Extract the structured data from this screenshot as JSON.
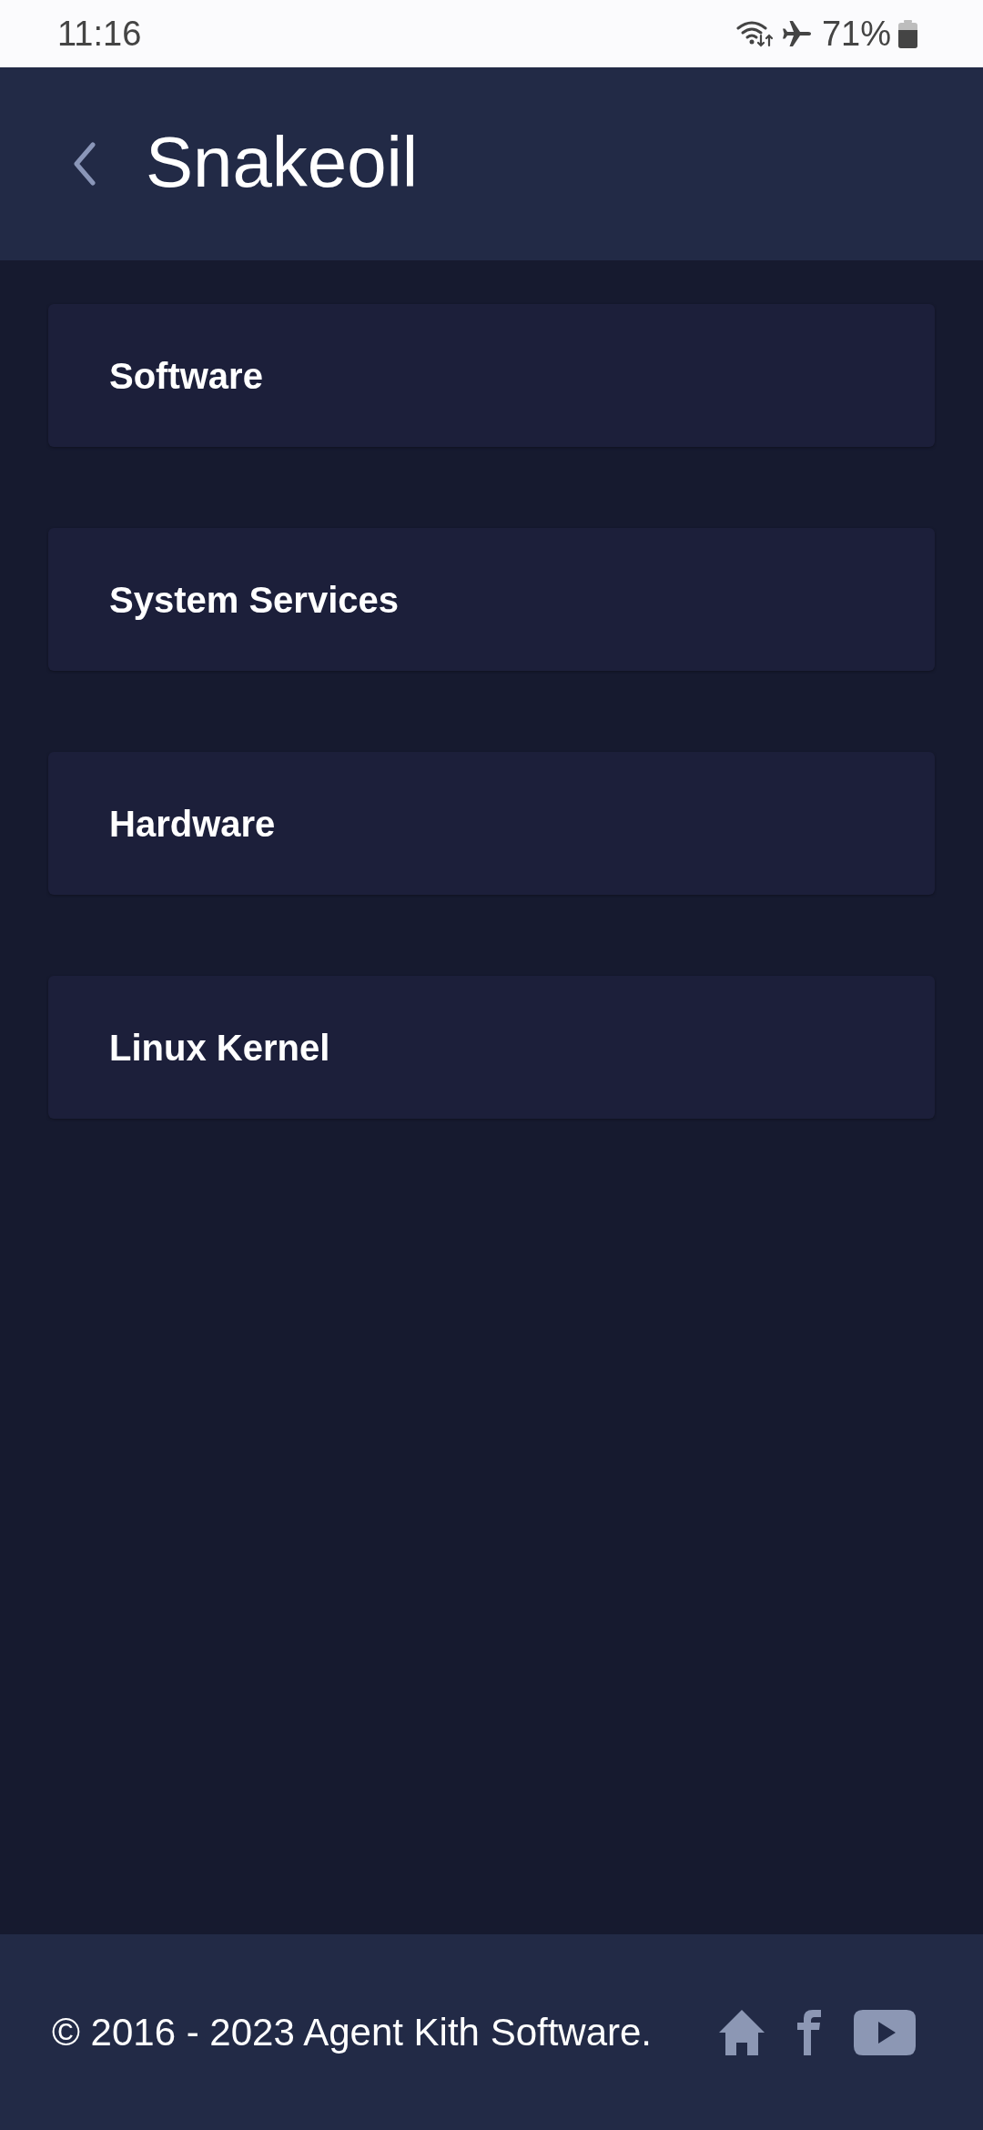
{
  "status_bar": {
    "time": "11:16",
    "battery": "71%"
  },
  "header": {
    "title": "Snakeoil"
  },
  "menu_items": [
    {
      "label": "Software"
    },
    {
      "label": "System Services"
    },
    {
      "label": "Hardware"
    },
    {
      "label": "Linux Kernel"
    }
  ],
  "footer": {
    "copyright": "© 2016 - 2023 Agent Kith Software."
  }
}
